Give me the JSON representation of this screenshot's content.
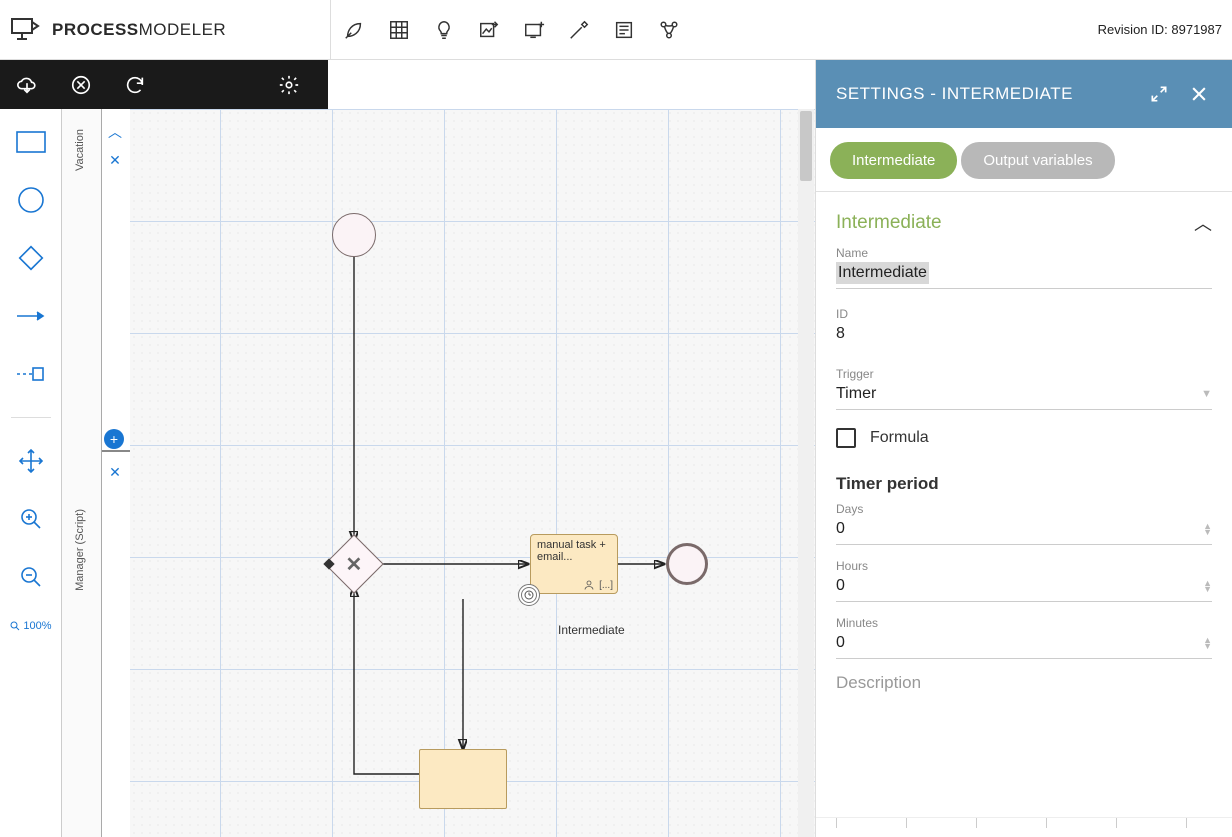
{
  "app": {
    "name_bold": "PROCESS",
    "name_light": "MODELER"
  },
  "revision": {
    "label": "Revision ID:",
    "value": "8971987"
  },
  "zoom": {
    "value": "100%"
  },
  "lanes": {
    "top": "Vacation",
    "bottom": "Manager (Script)"
  },
  "canvas": {
    "task1_label": "manual task + email...",
    "task1_marker": "[...]",
    "intermediate_label": "Intermediate"
  },
  "panel": {
    "header": "SETTINGS  -  INTERMEDIATE",
    "tabs": {
      "active": "Intermediate",
      "inactive": "Output variables"
    },
    "section_title": "Intermediate",
    "name": {
      "label": "Name",
      "value": "Intermediate"
    },
    "id": {
      "label": "ID",
      "value": "8"
    },
    "trigger": {
      "label": "Trigger",
      "value": "Timer"
    },
    "formula_label": "Formula",
    "timer_period_title": "Timer period",
    "days": {
      "label": "Days",
      "value": "0"
    },
    "hours": {
      "label": "Hours",
      "value": "0"
    },
    "minutes": {
      "label": "Minutes",
      "value": "0"
    },
    "description_label": "Description"
  }
}
